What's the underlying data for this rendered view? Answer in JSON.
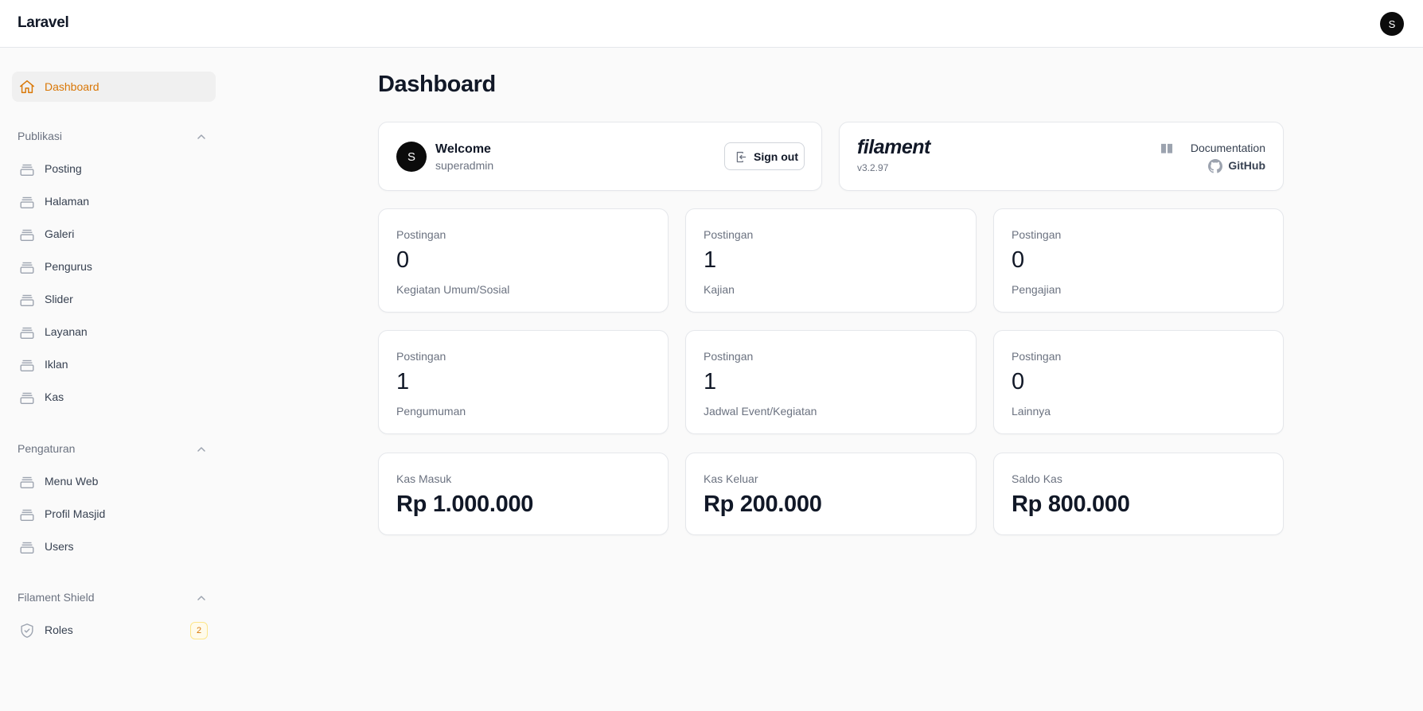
{
  "app": {
    "brand": "Laravel",
    "user_initial": "S"
  },
  "sidebar": {
    "active": {
      "label": "Dashboard",
      "icon": "home-icon",
      "color": "#d97706"
    },
    "groups": [
      {
        "title": "Publikasi",
        "items": [
          {
            "label": "Posting",
            "icon": "stack-icon"
          },
          {
            "label": "Halaman",
            "icon": "stack-icon"
          },
          {
            "label": "Galeri",
            "icon": "stack-icon"
          },
          {
            "label": "Pengurus",
            "icon": "stack-icon"
          },
          {
            "label": "Slider",
            "icon": "stack-icon"
          },
          {
            "label": "Layanan",
            "icon": "stack-icon"
          },
          {
            "label": "Iklan",
            "icon": "stack-icon"
          },
          {
            "label": "Kas",
            "icon": "stack-icon"
          }
        ]
      },
      {
        "title": "Pengaturan",
        "items": [
          {
            "label": "Menu Web",
            "icon": "stack-icon"
          },
          {
            "label": "Profil Masjid",
            "icon": "stack-icon"
          },
          {
            "label": "Users",
            "icon": "stack-icon"
          }
        ]
      },
      {
        "title": "Filament Shield",
        "items": [
          {
            "label": "Roles",
            "icon": "shield-check-icon",
            "badge": "2"
          }
        ]
      }
    ]
  },
  "main": {
    "title": "Dashboard",
    "account": {
      "initial": "S",
      "title": "Welcome",
      "username": "superadmin",
      "signout_label": "Sign out"
    },
    "filament": {
      "logo": "filament",
      "version": "v3.2.97",
      "doc_label": "Documentation",
      "github_label": "GitHub"
    },
    "stats": [
      {
        "label": "Postingan",
        "value": "0",
        "description": "Kegiatan Umum/Sosial"
      },
      {
        "label": "Postingan",
        "value": "1",
        "description": "Kajian"
      },
      {
        "label": "Postingan",
        "value": "0",
        "description": "Pengajian"
      },
      {
        "label": "Postingan",
        "value": "1",
        "description": "Pengumuman"
      },
      {
        "label": "Postingan",
        "value": "1",
        "description": "Jadwal Event/Kegiatan"
      },
      {
        "label": "Postingan",
        "value": "0",
        "description": "Lainnya"
      }
    ],
    "kas": [
      {
        "label": "Kas Masuk",
        "value": "Rp 1.000.000"
      },
      {
        "label": "Kas Keluar",
        "value": "Rp 200.000"
      },
      {
        "label": "Saldo Kas",
        "value": "Rp 800.000"
      }
    ]
  }
}
